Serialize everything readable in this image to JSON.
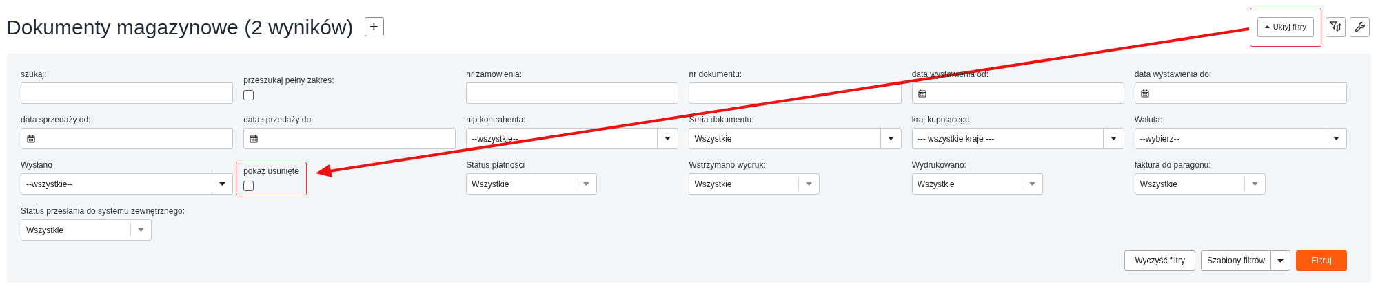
{
  "title": "Dokumenty magazynowe (2 wyników)",
  "add_button": "+",
  "header_buttons": {
    "hide_filters": {
      "label": "Ukryj filtry",
      "highlighted": true
    }
  },
  "filters": [
    {
      "kind": "text",
      "label": "szukaj:"
    },
    {
      "kind": "checkbox",
      "label": "przeszukaj pełny zakres:",
      "checked": false,
      "highlighted": false
    },
    {
      "kind": "text",
      "label": "nr zamówienia:"
    },
    {
      "kind": "text",
      "label": "nr dokumentu:"
    },
    {
      "kind": "date",
      "label": "data wystawienia od:"
    },
    {
      "kind": "date",
      "label": "data wystawienia do:"
    },
    {
      "kind": "date",
      "label": "data sprzedaży od:"
    },
    {
      "kind": "date",
      "label": "data sprzedaży do:"
    },
    {
      "kind": "select",
      "label": "nip kontrahenta:",
      "value": "--wszystkie--"
    },
    {
      "kind": "select",
      "label": "Seria dokumentu:",
      "value": "Wszystkie"
    },
    {
      "kind": "select",
      "label": "kraj kupującego",
      "value": "--- wszystkie kraje ---"
    },
    {
      "kind": "select",
      "label": "Waluta:",
      "value": "--wybierz--"
    },
    {
      "kind": "select",
      "label": "Wysłano",
      "value": "--wszystkie--"
    },
    {
      "kind": "checkbox",
      "label": "pokaż usunięte",
      "checked": false,
      "highlighted": true
    },
    {
      "kind": "compact-select",
      "label": "Status płatności",
      "value": "Wszystkie"
    },
    {
      "kind": "compact-select",
      "label": "Wstrzymano wydruk:",
      "value": "Wszystkie"
    },
    {
      "kind": "compact-select",
      "label": "Wydrukowano:",
      "value": "Wszystkie"
    },
    {
      "kind": "compact-select",
      "label": "faktura do paragonu:",
      "value": "Wszystkie"
    },
    {
      "kind": "compact-select",
      "label": "Status przesłania do systemu zewnętrznego:",
      "value": "Wszystkie"
    }
  ],
  "actions": {
    "clear": "Wyczyść filtry",
    "templates": "Szablony filtrów",
    "submit": "Filtruj"
  }
}
